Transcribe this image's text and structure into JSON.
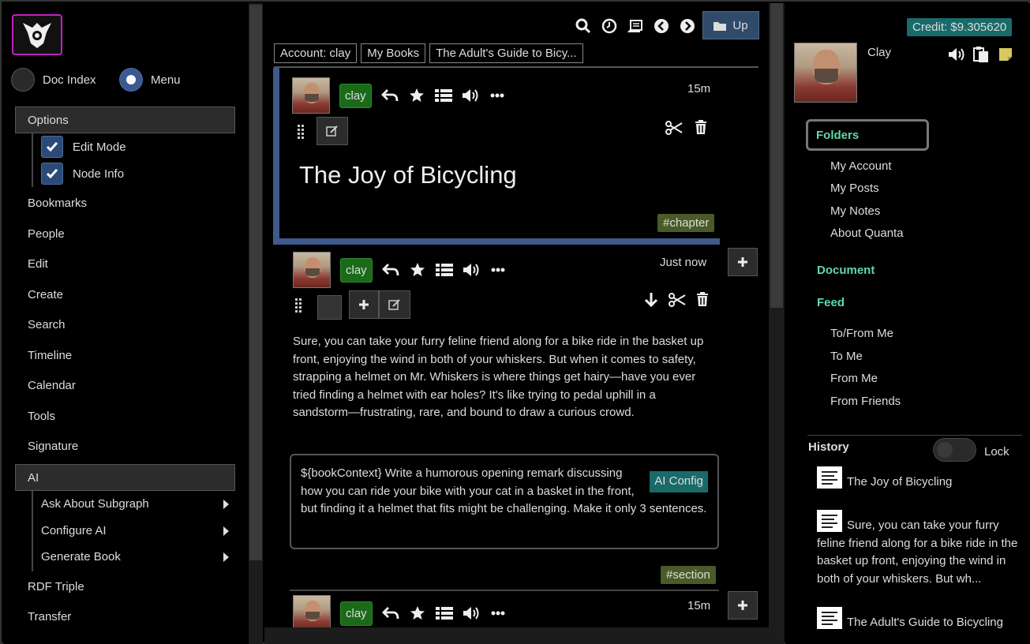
{
  "left": {
    "radio_doc_index": "Doc Index",
    "radio_menu": "Menu",
    "options_header": "Options",
    "edit_mode": "Edit Mode",
    "node_info": "Node Info",
    "items": [
      "Bookmarks",
      "People",
      "Edit",
      "Create",
      "Search",
      "Timeline",
      "Calendar",
      "Tools",
      "Signature"
    ],
    "ai_header": "AI",
    "ai_sub": [
      "Ask About Subgraph",
      "Configure AI",
      "Generate Book"
    ],
    "items2": [
      "RDF Triple",
      "Transfer"
    ]
  },
  "center": {
    "up_label": "Up",
    "breadcrumbs": [
      "Account: clay",
      "My Books",
      "The Adult's Guide to Bicy..."
    ],
    "node1": {
      "user": "clay",
      "time": "15m",
      "title": "The Joy of Bicycling",
      "tag": "#chapter"
    },
    "node2": {
      "user": "clay",
      "time": "Just now",
      "text": "Sure, you can take your furry feline friend along for a bike ride in the basket up front, enjoying the wind in both of your whiskers. But when it comes to safety, strapping a helmet on Mr. Whiskers is where things get hairy—have you ever tried finding a helmet with ear holes? It's like trying to pedal uphill in a sandstorm—frustrating, rare, and bound to draw a curious crowd.",
      "ai_prompt": "${bookContext} Write a humorous opening remark discussing how you can ride your bike with your cat in a basket in the front, but finding it a helmet that fits might be challenging. Make it only 3 sentences.",
      "ai_config": "AI Config",
      "tag": "#section"
    },
    "node3": {
      "user": "clay",
      "time": "15m"
    }
  },
  "right": {
    "credit": "Credit: $9.305620",
    "user_name": "Clay",
    "folders": "Folders",
    "folder_links": [
      "My Account",
      "My Posts",
      "My Notes",
      "About Quanta"
    ],
    "document": "Document",
    "feed": "Feed",
    "feed_links": [
      "To/From Me",
      "To Me",
      "From Me",
      "From Friends"
    ],
    "history_title": "History",
    "lock_label": "Lock",
    "history": [
      "The Joy of Bicycling",
      "Sure, you can take your furry feline friend along for a bike ride in the basket up front, enjoying the wind in both of your whiskers. But wh...",
      "The Adult's Guide to Bicycling"
    ]
  },
  "colors": {
    "accent_green": "#5fd9a8",
    "user_badge": "#1a6a1a",
    "tag_bg": "#4a5a28",
    "credit_bg": "#1a6a6a",
    "node_border": "#3e5a8a",
    "logo_border": "#c020c0"
  }
}
